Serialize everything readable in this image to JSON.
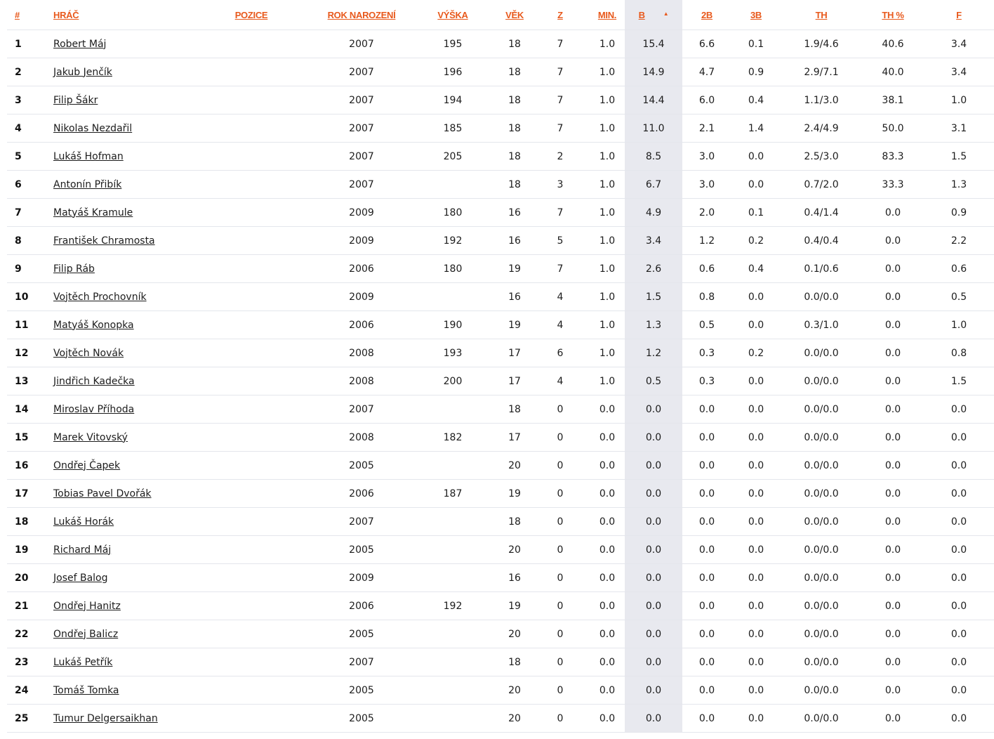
{
  "headers": {
    "num": "#",
    "player": "HRÁČ",
    "position": "POZICE",
    "birth_year": "ROK NAROZENÍ",
    "height": "VÝŠKA",
    "age": "VĚK",
    "games": "Z",
    "minutes": "MIN.",
    "points": "B",
    "two_pt": "2B",
    "three_pt": "3B",
    "free_throws": "TH",
    "free_throw_pct": "TH %",
    "fouls": "F"
  },
  "sorted_column": "points",
  "sort_direction": "desc",
  "colors": {
    "header_accent": "#e8591c",
    "sorted_column_bg": "#e8e9ef",
    "row_border": "#e4e6ec"
  },
  "rows": [
    {
      "num": "1",
      "name": "Robert Máj",
      "position": "",
      "birth_year": "2007",
      "height": "195",
      "age": "18",
      "games": "7",
      "minutes": "1.0",
      "points": "15.4",
      "two_pt": "6.6",
      "three_pt": "0.1",
      "free_throws": "1.9/4.6",
      "free_throw_pct": "40.6",
      "fouls": "3.4"
    },
    {
      "num": "2",
      "name": "Jakub Jenčík",
      "position": "",
      "birth_year": "2007",
      "height": "196",
      "age": "18",
      "games": "7",
      "minutes": "1.0",
      "points": "14.9",
      "two_pt": "4.7",
      "three_pt": "0.9",
      "free_throws": "2.9/7.1",
      "free_throw_pct": "40.0",
      "fouls": "3.4"
    },
    {
      "num": "3",
      "name": "Filip Šákr",
      "position": "",
      "birth_year": "2007",
      "height": "194",
      "age": "18",
      "games": "7",
      "minutes": "1.0",
      "points": "14.4",
      "two_pt": "6.0",
      "three_pt": "0.4",
      "free_throws": "1.1/3.0",
      "free_throw_pct": "38.1",
      "fouls": "1.0"
    },
    {
      "num": "4",
      "name": "Nikolas Nezdařil",
      "position": "",
      "birth_year": "2007",
      "height": "185",
      "age": "18",
      "games": "7",
      "minutes": "1.0",
      "points": "11.0",
      "two_pt": "2.1",
      "three_pt": "1.4",
      "free_throws": "2.4/4.9",
      "free_throw_pct": "50.0",
      "fouls": "3.1"
    },
    {
      "num": "5",
      "name": "Lukáš Hofman",
      "position": "",
      "birth_year": "2007",
      "height": "205",
      "age": "18",
      "games": "2",
      "minutes": "1.0",
      "points": "8.5",
      "two_pt": "3.0",
      "three_pt": "0.0",
      "free_throws": "2.5/3.0",
      "free_throw_pct": "83.3",
      "fouls": "1.5"
    },
    {
      "num": "6",
      "name": "Antonín Přibík",
      "position": "",
      "birth_year": "2007",
      "height": "",
      "age": "18",
      "games": "3",
      "minutes": "1.0",
      "points": "6.7",
      "two_pt": "3.0",
      "three_pt": "0.0",
      "free_throws": "0.7/2.0",
      "free_throw_pct": "33.3",
      "fouls": "1.3"
    },
    {
      "num": "7",
      "name": "Matyáš Kramule",
      "position": "",
      "birth_year": "2009",
      "height": "180",
      "age": "16",
      "games": "7",
      "minutes": "1.0",
      "points": "4.9",
      "two_pt": "2.0",
      "three_pt": "0.1",
      "free_throws": "0.4/1.4",
      "free_throw_pct": "0.0",
      "fouls": "0.9"
    },
    {
      "num": "8",
      "name": "František Chramosta",
      "position": "",
      "birth_year": "2009",
      "height": "192",
      "age": "16",
      "games": "5",
      "minutes": "1.0",
      "points": "3.4",
      "two_pt": "1.2",
      "three_pt": "0.2",
      "free_throws": "0.4/0.4",
      "free_throw_pct": "0.0",
      "fouls": "2.2"
    },
    {
      "num": "9",
      "name": "Filip Ráb",
      "position": "",
      "birth_year": "2006",
      "height": "180",
      "age": "19",
      "games": "7",
      "minutes": "1.0",
      "points": "2.6",
      "two_pt": "0.6",
      "three_pt": "0.4",
      "free_throws": "0.1/0.6",
      "free_throw_pct": "0.0",
      "fouls": "0.6"
    },
    {
      "num": "10",
      "name": "Vojtěch Prochovník",
      "position": "",
      "birth_year": "2009",
      "height": "",
      "age": "16",
      "games": "4",
      "minutes": "1.0",
      "points": "1.5",
      "two_pt": "0.8",
      "three_pt": "0.0",
      "free_throws": "0.0/0.0",
      "free_throw_pct": "0.0",
      "fouls": "0.5"
    },
    {
      "num": "11",
      "name": "Matyáš Konopka",
      "position": "",
      "birth_year": "2006",
      "height": "190",
      "age": "19",
      "games": "4",
      "minutes": "1.0",
      "points": "1.3",
      "two_pt": "0.5",
      "three_pt": "0.0",
      "free_throws": "0.3/1.0",
      "free_throw_pct": "0.0",
      "fouls": "1.0"
    },
    {
      "num": "12",
      "name": "Vojtěch Novák",
      "position": "",
      "birth_year": "2008",
      "height": "193",
      "age": "17",
      "games": "6",
      "minutes": "1.0",
      "points": "1.2",
      "two_pt": "0.3",
      "three_pt": "0.2",
      "free_throws": "0.0/0.0",
      "free_throw_pct": "0.0",
      "fouls": "0.8"
    },
    {
      "num": "13",
      "name": "Jindřich Kadečka",
      "position": "",
      "birth_year": "2008",
      "height": "200",
      "age": "17",
      "games": "4",
      "minutes": "1.0",
      "points": "0.5",
      "two_pt": "0.3",
      "three_pt": "0.0",
      "free_throws": "0.0/0.0",
      "free_throw_pct": "0.0",
      "fouls": "1.5"
    },
    {
      "num": "14",
      "name": "Miroslav Příhoda",
      "position": "",
      "birth_year": "2007",
      "height": "",
      "age": "18",
      "games": "0",
      "minutes": "0.0",
      "points": "0.0",
      "two_pt": "0.0",
      "three_pt": "0.0",
      "free_throws": "0.0/0.0",
      "free_throw_pct": "0.0",
      "fouls": "0.0"
    },
    {
      "num": "15",
      "name": "Marek Vitovský",
      "position": "",
      "birth_year": "2008",
      "height": "182",
      "age": "17",
      "games": "0",
      "minutes": "0.0",
      "points": "0.0",
      "two_pt": "0.0",
      "three_pt": "0.0",
      "free_throws": "0.0/0.0",
      "free_throw_pct": "0.0",
      "fouls": "0.0"
    },
    {
      "num": "16",
      "name": "Ondřej Čapek",
      "position": "",
      "birth_year": "2005",
      "height": "",
      "age": "20",
      "games": "0",
      "minutes": "0.0",
      "points": "0.0",
      "two_pt": "0.0",
      "three_pt": "0.0",
      "free_throws": "0.0/0.0",
      "free_throw_pct": "0.0",
      "fouls": "0.0"
    },
    {
      "num": "17",
      "name": "Tobias Pavel Dvořák",
      "position": "",
      "birth_year": "2006",
      "height": "187",
      "age": "19",
      "games": "0",
      "minutes": "0.0",
      "points": "0.0",
      "two_pt": "0.0",
      "three_pt": "0.0",
      "free_throws": "0.0/0.0",
      "free_throw_pct": "0.0",
      "fouls": "0.0"
    },
    {
      "num": "18",
      "name": "Lukáš Horák",
      "position": "",
      "birth_year": "2007",
      "height": "",
      "age": "18",
      "games": "0",
      "minutes": "0.0",
      "points": "0.0",
      "two_pt": "0.0",
      "three_pt": "0.0",
      "free_throws": "0.0/0.0",
      "free_throw_pct": "0.0",
      "fouls": "0.0"
    },
    {
      "num": "19",
      "name": "Richard Máj",
      "position": "",
      "birth_year": "2005",
      "height": "",
      "age": "20",
      "games": "0",
      "minutes": "0.0",
      "points": "0.0",
      "two_pt": "0.0",
      "three_pt": "0.0",
      "free_throws": "0.0/0.0",
      "free_throw_pct": "0.0",
      "fouls": "0.0"
    },
    {
      "num": "20",
      "name": "Josef Balog",
      "position": "",
      "birth_year": "2009",
      "height": "",
      "age": "16",
      "games": "0",
      "minutes": "0.0",
      "points": "0.0",
      "two_pt": "0.0",
      "three_pt": "0.0",
      "free_throws": "0.0/0.0",
      "free_throw_pct": "0.0",
      "fouls": "0.0"
    },
    {
      "num": "21",
      "name": "Ondřej Hanitz",
      "position": "",
      "birth_year": "2006",
      "height": "192",
      "age": "19",
      "games": "0",
      "minutes": "0.0",
      "points": "0.0",
      "two_pt": "0.0",
      "three_pt": "0.0",
      "free_throws": "0.0/0.0",
      "free_throw_pct": "0.0",
      "fouls": "0.0"
    },
    {
      "num": "22",
      "name": "Ondřej Balicz",
      "position": "",
      "birth_year": "2005",
      "height": "",
      "age": "20",
      "games": "0",
      "minutes": "0.0",
      "points": "0.0",
      "two_pt": "0.0",
      "three_pt": "0.0",
      "free_throws": "0.0/0.0",
      "free_throw_pct": "0.0",
      "fouls": "0.0"
    },
    {
      "num": "23",
      "name": "Lukáš Petřík",
      "position": "",
      "birth_year": "2007",
      "height": "",
      "age": "18",
      "games": "0",
      "minutes": "0.0",
      "points": "0.0",
      "two_pt": "0.0",
      "three_pt": "0.0",
      "free_throws": "0.0/0.0",
      "free_throw_pct": "0.0",
      "fouls": "0.0"
    },
    {
      "num": "24",
      "name": "Tomáš Tomka",
      "position": "",
      "birth_year": "2005",
      "height": "",
      "age": "20",
      "games": "0",
      "minutes": "0.0",
      "points": "0.0",
      "two_pt": "0.0",
      "three_pt": "0.0",
      "free_throws": "0.0/0.0",
      "free_throw_pct": "0.0",
      "fouls": "0.0"
    },
    {
      "num": "25",
      "name": "Tumur Delgersaikhan",
      "position": "",
      "birth_year": "2005",
      "height": "",
      "age": "20",
      "games": "0",
      "minutes": "0.0",
      "points": "0.0",
      "two_pt": "0.0",
      "three_pt": "0.0",
      "free_throws": "0.0/0.0",
      "free_throw_pct": "0.0",
      "fouls": "0.0"
    }
  ]
}
